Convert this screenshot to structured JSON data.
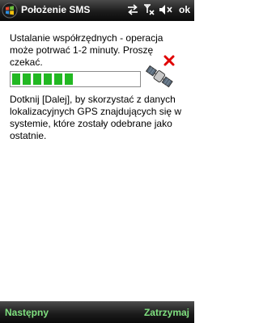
{
  "titlebar": {
    "title": "Położenie SMS",
    "ok_label": "ok",
    "icons": [
      "windows-start-icon",
      "sync-arrows-icon",
      "no-signal-icon",
      "speaker-mute-icon"
    ]
  },
  "content": {
    "wait_message": "Ustalanie współrzędnych - operacja może potrwać 1-2 minuty. Proszę czekać.",
    "progress_value": 0.5,
    "progress_status_icon": "satellite-with-red-x-icon",
    "gps_info": "Dotknij [Dalej], by skorzystać z danych lokalizacyjnych GPS znajdujących się w systemie, które zostały odebrane jako ostatnie."
  },
  "softkeys": {
    "left_label": "Następny",
    "right_label": "Zatrzymaj"
  },
  "colors": {
    "progress_fill": "#22b822",
    "softkey_text": "#7fe07f",
    "error_x": "#e00000"
  }
}
